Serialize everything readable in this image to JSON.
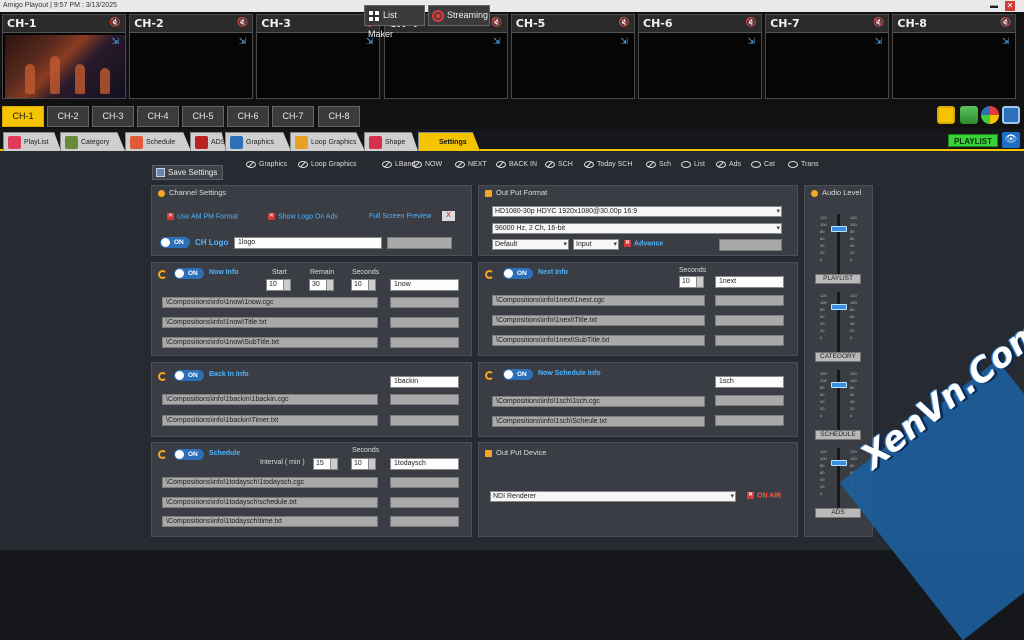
{
  "window": {
    "title": "Amigo Playout | 9:57 PM : 3/13/2025",
    "min": "▬",
    "close": "✕"
  },
  "monitors": [
    {
      "name": "CH-1"
    },
    {
      "name": "CH-2"
    },
    {
      "name": "CH-3"
    },
    {
      "name": "CH-4"
    },
    {
      "name": "CH-5"
    },
    {
      "name": "CH-6"
    },
    {
      "name": "CH-7"
    },
    {
      "name": "CH-8"
    }
  ],
  "channels": [
    "CH-1",
    "CH-2",
    "CH-3",
    "CH-4",
    "CH-5",
    "CH-6",
    "CH-7",
    "CH-8"
  ],
  "active_channel": "CH-1",
  "list_maker": "List Maker",
  "streaming": "Streaming",
  "tabs": [
    "PlayList",
    "Category",
    "Schedule",
    "ADS",
    "Graphics",
    "Loop Graphics",
    "Shape",
    "Settings"
  ],
  "active_tab": "Settings",
  "playlist_button": "PLAYLIST",
  "toggles": [
    "Graphics",
    "Loop Graphics",
    "LBand",
    "NOW",
    "NEXT",
    "BACK IN",
    "SCH",
    "Today SCH",
    "Sch",
    "List",
    "Ads",
    "Cat",
    "Trans"
  ],
  "save": "Save Settings",
  "channel_settings": {
    "title": "Channel Settings",
    "ampm": "Use AM PM Format",
    "logo_on_ads": "Show Logo On Ads",
    "full_screen": "Full Screen Preview",
    "full_screen_x": "X",
    "toggle": "ON",
    "ch_logo": "CH Logo",
    "logo_value": "1logo"
  },
  "now_info": {
    "toggle": "ON",
    "title": "Now Info",
    "start_label": "Start",
    "remain_label": "Remain",
    "seconds_label": "Seconds",
    "start": "10",
    "remain": "30",
    "seconds": "10",
    "name": "1now",
    "paths": [
      "\\Compositions\\info\\1now\\1now.cgc",
      "\\Compositions\\info\\1now\\Title.txt",
      "\\Compositions\\info\\1now\\SubTitle.txt"
    ]
  },
  "back_in": {
    "toggle": "ON",
    "title": "Back In Info",
    "name": "1backin",
    "paths": [
      "\\Compositions\\info\\1backin\\1backin.cgc",
      "\\Compositions\\info\\1backin\\Timer.txt"
    ]
  },
  "schedule": {
    "toggle": "ON",
    "title": "Schedule",
    "interval_label": "Interval ( min )",
    "seconds_label": "Seconds",
    "interval": "15",
    "seconds": "10",
    "name": "1todaysch",
    "paths": [
      "\\Compositions\\info\\1todaysch\\1todaysch.cgc",
      "\\Compositions\\info\\1todaysch\\schedule.txt",
      "\\Compositions\\info\\1todaysch\\time.txt"
    ]
  },
  "output_format": {
    "title": "Out Put Format",
    "video": "HD1080-30p HDYC 1920x1080@30.00p 16:9",
    "audio": "96000 Hz, 2 Ch, 16-bit",
    "mode": "Default",
    "input": "Input",
    "advance": "Advance"
  },
  "next_info": {
    "toggle": "ON",
    "title": "Next Info",
    "seconds_label": "Seconds",
    "seconds": "10",
    "name": "1next",
    "paths": [
      "\\Compositions\\info\\1next\\1next.cgc",
      "\\Compositions\\info\\1next\\Title.txt",
      "\\Compositions\\info\\1next\\SubTitle.txt"
    ]
  },
  "now_schedule": {
    "toggle": "ON",
    "title": "Now Schedule Info",
    "name": "1sch",
    "paths": [
      "\\Compositions\\info\\1sch\\1sch.cgc",
      "\\Compositions\\info\\1sch\\Scheule.txt"
    ]
  },
  "output_device": {
    "title": "Out Put Device",
    "device": "NDI Renderer",
    "on_air": "ON AIR"
  },
  "audio": {
    "title": "Audio Level",
    "ticks": [
      "120",
      "100",
      "80",
      "60",
      "40",
      "20",
      "0"
    ],
    "faders": [
      {
        "label": "PLAYLIST",
        "level": 0.8
      },
      {
        "label": "CATEGORY",
        "level": 0.8
      },
      {
        "label": "SCHEDULE",
        "level": 0.8
      },
      {
        "label": "ADS",
        "level": 0.8
      }
    ]
  },
  "watermark": "XenVn.Com"
}
